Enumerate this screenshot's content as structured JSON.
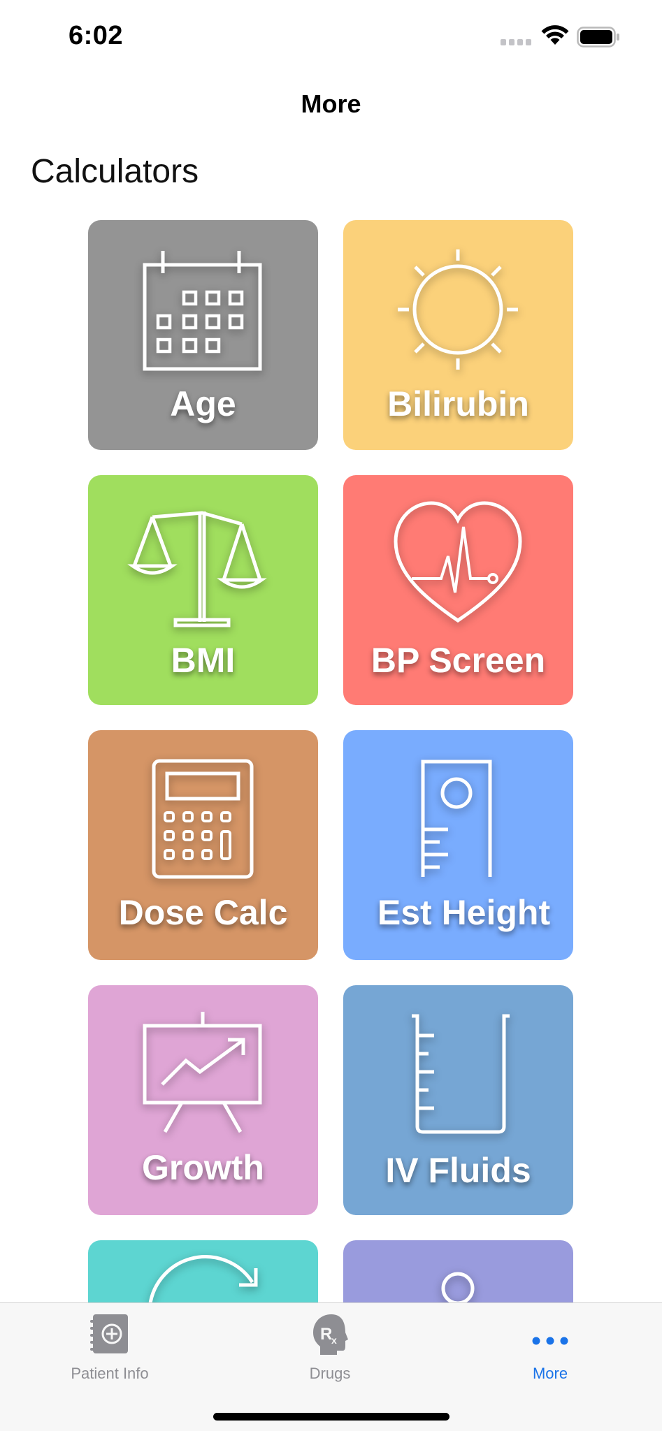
{
  "status_bar": {
    "time": "6:02"
  },
  "nav": {
    "title": "More"
  },
  "section": {
    "title": "Calculators"
  },
  "tiles": [
    {
      "label": "Age",
      "color": "#949494",
      "icon": "calendar-icon"
    },
    {
      "label": "Bilirubin",
      "color": "#fbd17a",
      "icon": "sun-icon"
    },
    {
      "label": "BMI",
      "color": "#a0de5e",
      "icon": "scale-icon"
    },
    {
      "label": "BP Screen",
      "color": "#ff7b74",
      "icon": "heart-pulse-icon"
    },
    {
      "label": "Dose Calc",
      "color": "#d59566",
      "icon": "calculator-icon"
    },
    {
      "label": "Est Height",
      "color": "#79acfe",
      "icon": "height-ruler-icon"
    },
    {
      "label": "Growth",
      "color": "#dfa5d5",
      "icon": "growth-chart-icon"
    },
    {
      "label": "IV Fluids",
      "color": "#76a6d4",
      "icon": "beaker-icon"
    },
    {
      "label": "",
      "color": "#5dd5d1",
      "icon": "refresh-icon"
    },
    {
      "label": "",
      "color": "#999bdd",
      "icon": "person-icon"
    }
  ],
  "tab_bar": {
    "tabs": [
      {
        "label": "Patient Info",
        "icon": "patient-record-icon",
        "active": false
      },
      {
        "label": "Drugs",
        "icon": "rx-head-icon",
        "active": false
      },
      {
        "label": "More",
        "icon": "more-dots-icon",
        "active": true
      }
    ],
    "active_color": "#1a73e8",
    "inactive_color": "#8e8e93"
  }
}
